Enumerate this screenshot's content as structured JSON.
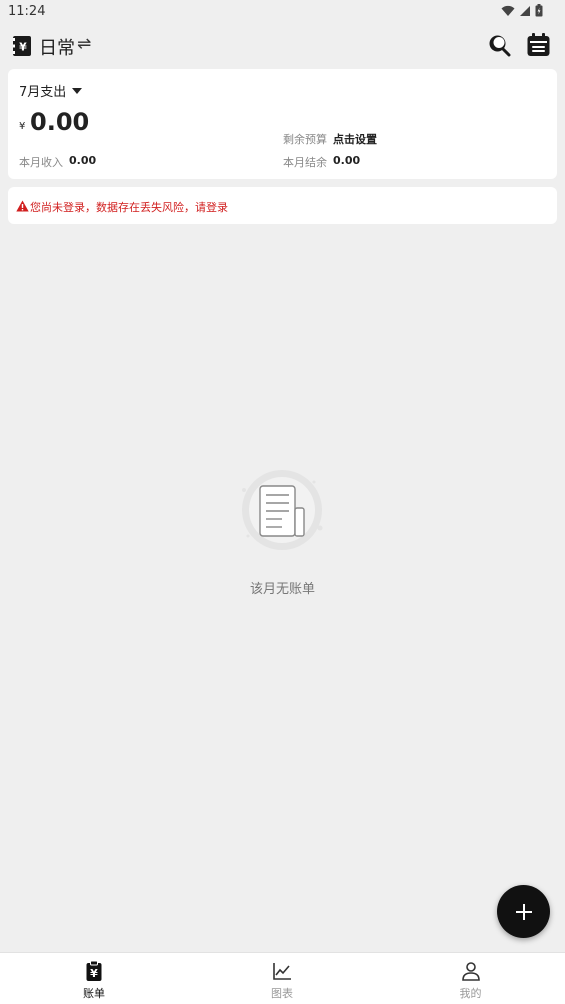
{
  "status_bar": {
    "time": "11:24"
  },
  "header": {
    "book_name": "日常",
    "swap_symbol": "⇌"
  },
  "summary": {
    "month_label": "7月支出",
    "currency_symbol": "¥",
    "expense_amount": "0.00",
    "budget_label": "剩余预算",
    "budget_value": "点击设置",
    "income_label": "本月收入",
    "income_value": "0.00",
    "balance_label": "本月结余",
    "balance_value": "0.00"
  },
  "warning": {
    "text": "您尚未登录，数据存在丢失风险，请登录",
    "color": "#d11f1f"
  },
  "empty_state": {
    "text": "该月无账单"
  },
  "fab": {
    "symbol": "+"
  },
  "bottom_nav": {
    "items": [
      {
        "label": "账单",
        "icon": "bill-clipboard-icon",
        "active": true
      },
      {
        "label": "图表",
        "icon": "line-chart-icon",
        "active": false
      },
      {
        "label": "我的",
        "icon": "person-icon",
        "active": false
      }
    ]
  }
}
